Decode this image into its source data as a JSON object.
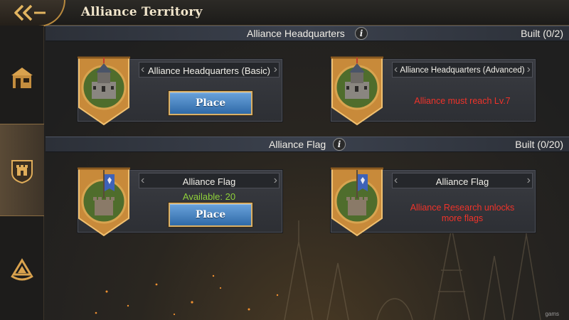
{
  "header": {
    "title": "Alliance Territory"
  },
  "sidebar": {
    "tabs": [
      {
        "icon": "building-icon"
      },
      {
        "icon": "fortress-shield-icon",
        "selected": true
      },
      {
        "icon": "alliance-emblem-icon"
      }
    ]
  },
  "sections": [
    {
      "title": "Alliance Headquarters",
      "built": "Built (0/2)",
      "cards": [
        {
          "name": "Alliance Headquarters (Basic)",
          "action_label": "Place"
        },
        {
          "name": "Alliance Headquarters (Advanced)",
          "message": "Alliance must reach Lv.7"
        }
      ]
    },
    {
      "title": "Alliance Flag",
      "built": "Built (0/20)",
      "cards": [
        {
          "name": "Alliance Flag",
          "available": "Available: 20",
          "action_label": "Place"
        },
        {
          "name": "Alliance Flag",
          "message_line1": "Alliance Research unlocks",
          "message_line2": "more flags"
        }
      ]
    }
  ],
  "info_icon_label": "i",
  "watermark": "gams",
  "colors": {
    "accent_gold": "#d8b06a",
    "button_blue": "#2f6aa8",
    "available_green": "#8fd13a",
    "warning_red": "#f0332a"
  }
}
